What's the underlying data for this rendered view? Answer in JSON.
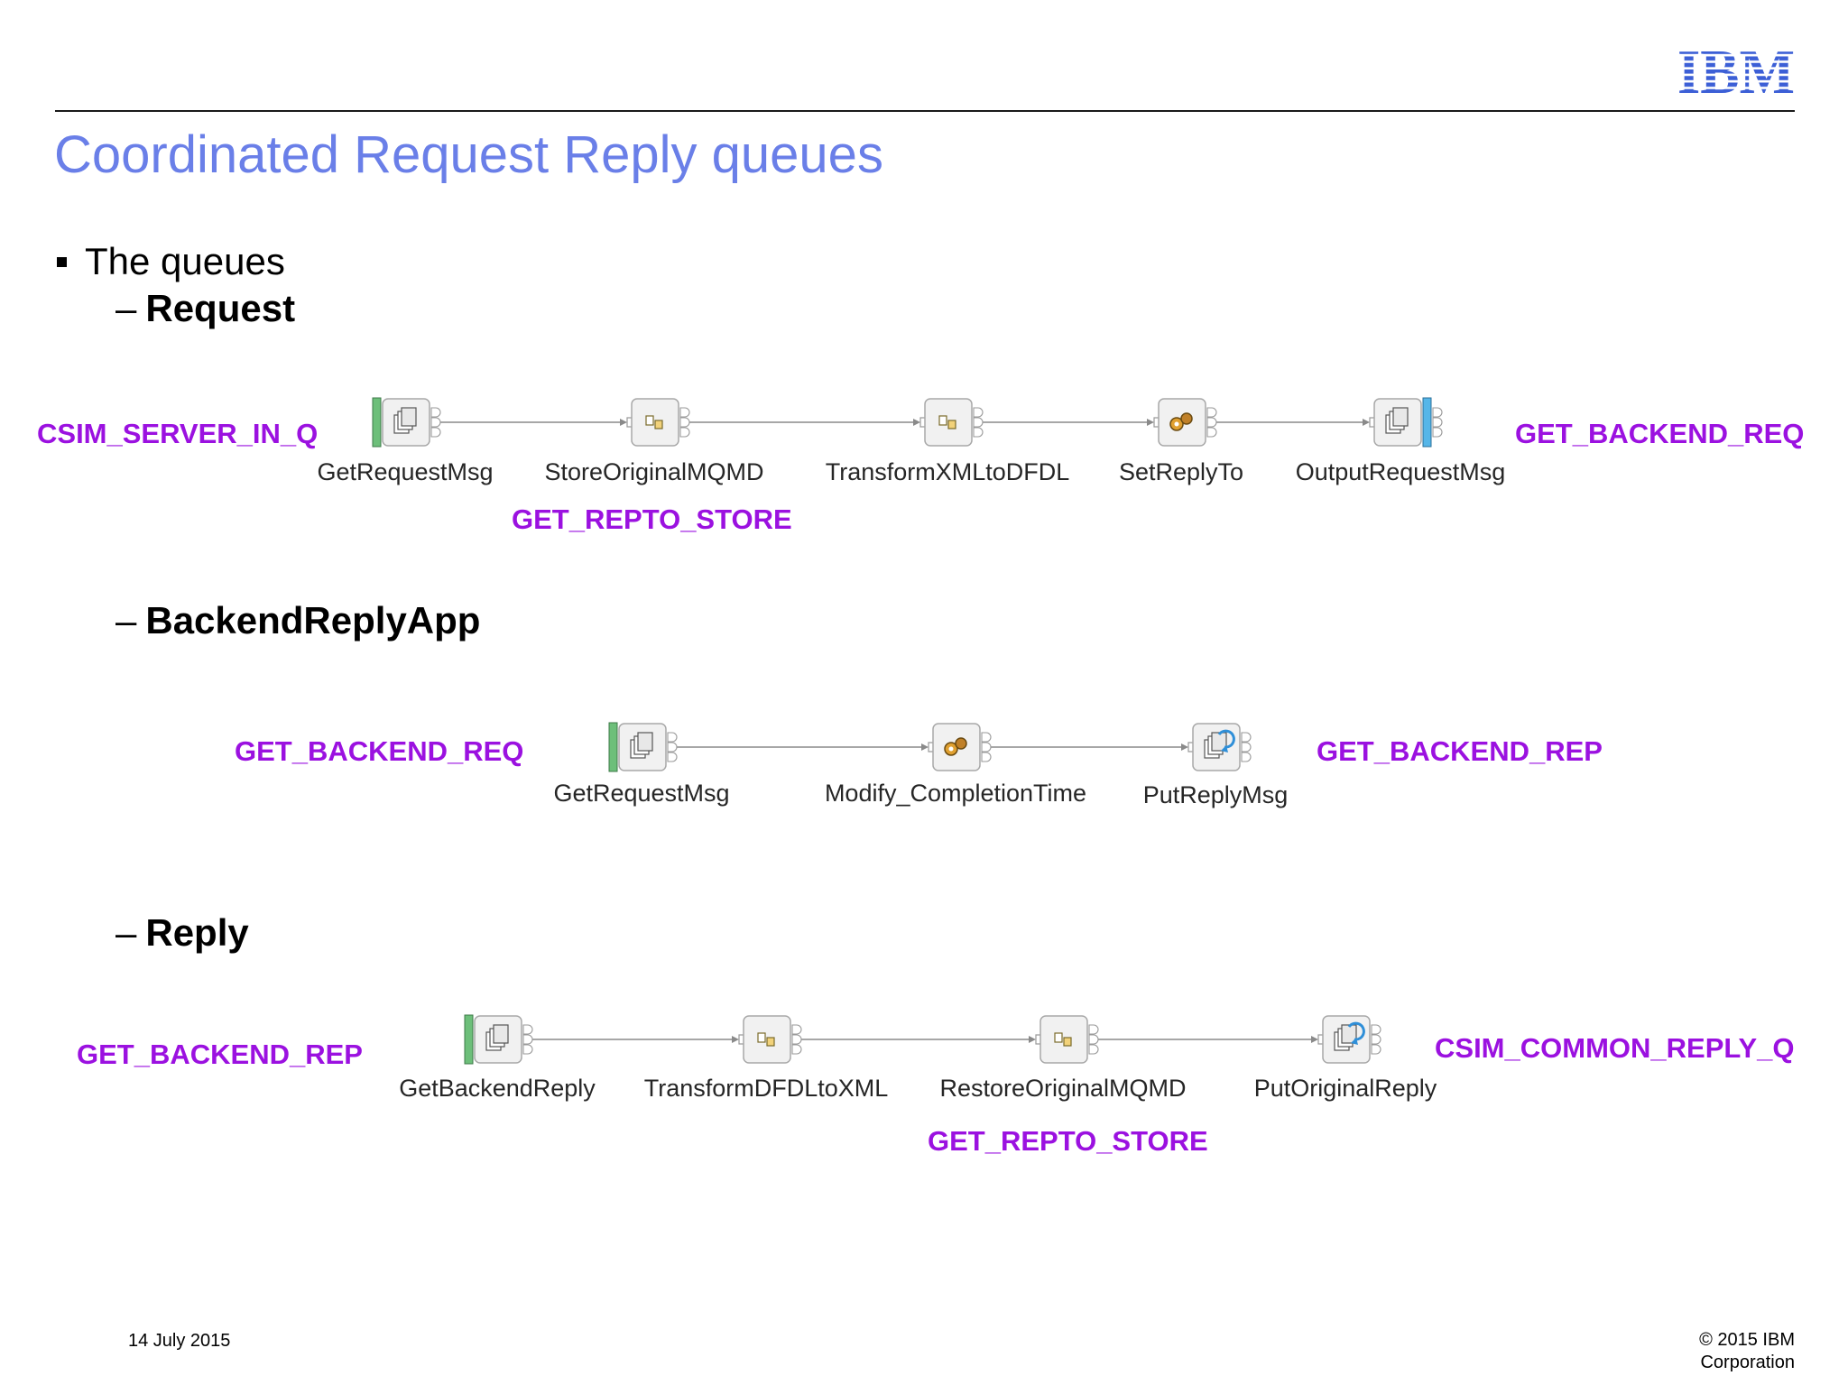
{
  "header": {
    "logo_text": "IBM",
    "title": "Coordinated Request Reply queues"
  },
  "content": {
    "bullet": "The queues",
    "sections": [
      {
        "heading": "Request",
        "left_queue": "CSIM_SERVER_IN_Q",
        "right_queue": "GET_BACKEND_REQ",
        "nodes": [
          "GetRequestMsg",
          "StoreOriginalMQMD",
          "TransformXMLtoDFDL",
          "SetReplyTo",
          "OutputRequestMsg"
        ],
        "node_icons": [
          "mq-input-icon",
          "compute-icon",
          "compute-icon",
          "gears-icon",
          "mq-output-icon"
        ],
        "extra_queue": "GET_REPTO_STORE"
      },
      {
        "heading": "BackendReplyApp",
        "left_queue": "GET_BACKEND_REQ",
        "right_queue": "GET_BACKEND_REP",
        "nodes": [
          "GetRequestMsg",
          "Modify_CompletionTime",
          "PutReplyMsg"
        ],
        "node_icons": [
          "mq-input-icon",
          "gears-icon",
          "mq-reply-icon"
        ]
      },
      {
        "heading": "Reply",
        "left_queue": "GET_BACKEND_REP",
        "right_queue": "CSIM_COMMON_REPLY_Q",
        "nodes": [
          "GetBackendReply",
          "TransformDFDLtoXML",
          "RestoreOriginalMQMD",
          "PutOriginalReply"
        ],
        "node_icons": [
          "mq-input-icon",
          "compute-icon",
          "compute-icon",
          "mq-reply-icon"
        ],
        "extra_queue": "GET_REPTO_STORE"
      }
    ]
  },
  "footer": {
    "date": "14 July 2015",
    "copyright_line1": "© 2015 IBM",
    "copyright_line2": "Corporation"
  },
  "colors": {
    "title": "#6a7fe8",
    "queue": "#9b11e0",
    "logo": "#3c5fd6"
  }
}
